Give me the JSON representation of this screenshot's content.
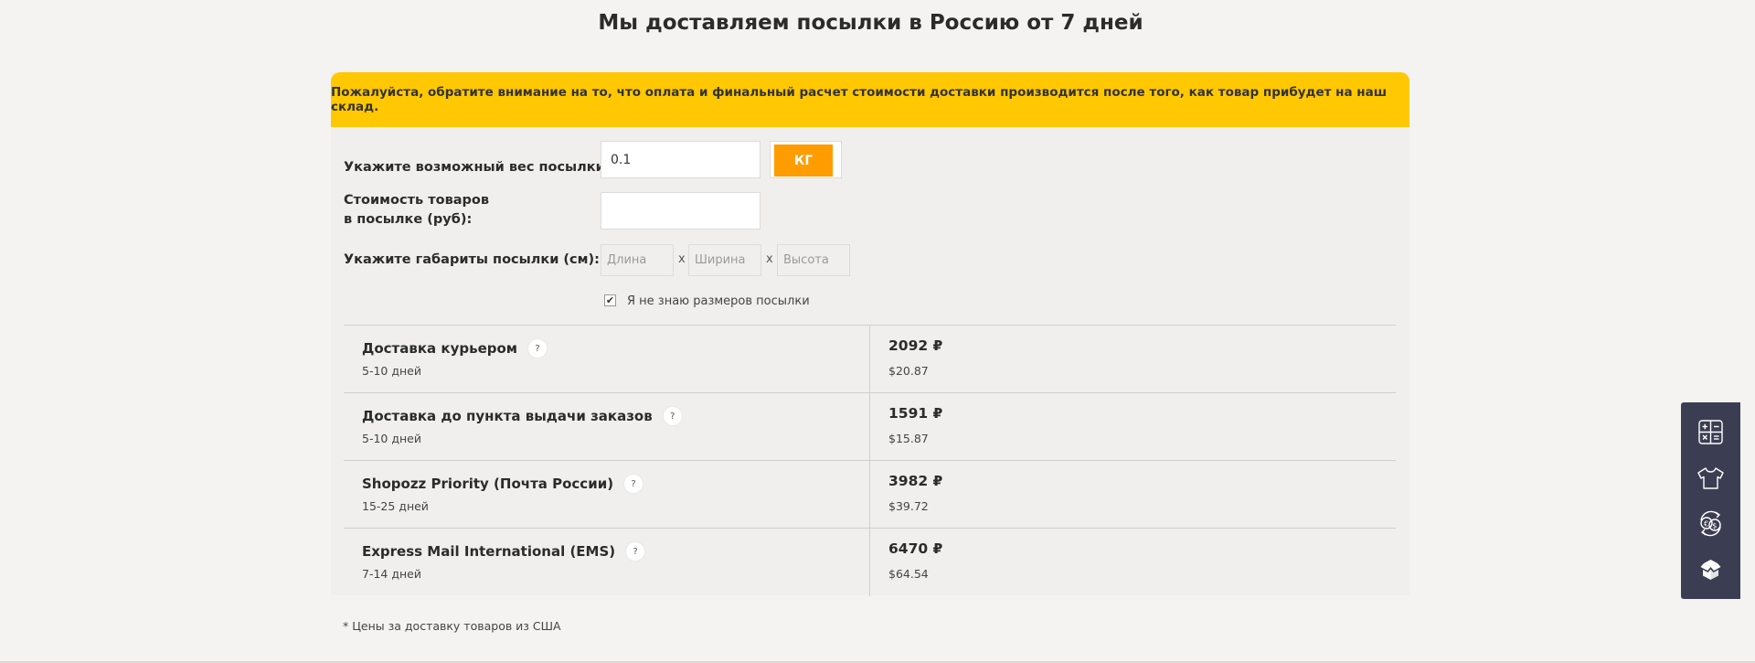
{
  "page": {
    "title": "Мы доставляем посылки в Россию от 7 дней"
  },
  "notice": {
    "text": "Пожалуйста, обратите внимание на то, что оплата и финальный расчет стоимости доставки производится после того, как товар прибудет на наш склад."
  },
  "form": {
    "weight_label": "Укажите возможный вес посылки:",
    "weight_value": "0.1",
    "unit_label": "КГ",
    "cost_label_line1": "Стоимость товаров",
    "cost_label_line2": "в посылке (руб):",
    "cost_value": "",
    "dims_label": "Укажите габариты посылки (см):",
    "length_placeholder": "Длина",
    "width_placeholder": "Ширина",
    "height_placeholder": "Высота",
    "dims_separator": "x",
    "unknown_size_label": "Я не знаю размеров посылки",
    "unknown_size_checked": true
  },
  "results": [
    {
      "name": "Доставка курьером",
      "days": "5-10 дней",
      "price_rub": "2092 ₽",
      "price_usd": "$20.87"
    },
    {
      "name": "Доставка до пункта выдачи заказов",
      "days": "5-10 дней",
      "price_rub": "1591 ₽",
      "price_usd": "$15.87"
    },
    {
      "name": "Shopozz Priority (Почта России)",
      "days": "15-25 дней",
      "price_rub": "3982 ₽",
      "price_usd": "$39.72"
    },
    {
      "name": "Express Mail International (EMS)",
      "days": "7-14 дней",
      "price_rub": "6470 ₽",
      "price_usd": "$64.54"
    }
  ],
  "help_glyph": "?",
  "check_glyph": "✔",
  "footnote": "* Цены за доставку товаров из США",
  "side_panel": {
    "icons": [
      "calculator-icon",
      "tshirt-icon",
      "currency-exchange-icon",
      "box-icon"
    ]
  },
  "colors": {
    "notice_bg": "#ffc803",
    "unit_button": "#ff9c00",
    "side_panel_bg": "#3b3e52"
  }
}
